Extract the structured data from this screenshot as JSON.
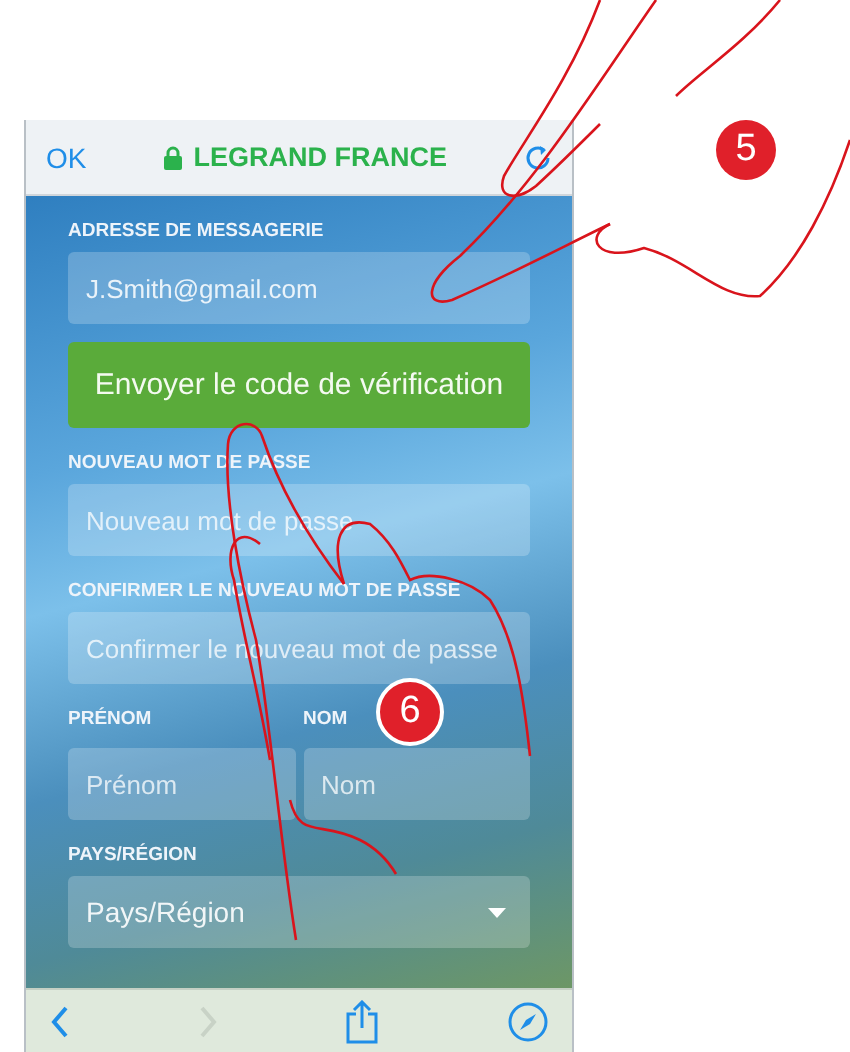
{
  "top_bar": {
    "done": "OK",
    "title": "LEGRAND FRANCE"
  },
  "form": {
    "email": {
      "label": "ADRESSE DE MESSAGERIE",
      "value": "J.Smith@gmail.com"
    },
    "send_button": "Envoyer le code de vérification",
    "new_password": {
      "label": "NOUVEAU MOT DE PASSE",
      "placeholder": "Nouveau mot de passe"
    },
    "confirm_password": {
      "label": "CONFIRMER LE NOUVEAU MOT DE PASSE",
      "placeholder": "Confirmer le nouveau mot de passe"
    },
    "first_name": {
      "label": "PRÉNOM",
      "placeholder": "Prénom"
    },
    "last_name": {
      "label": "NOM",
      "placeholder": "Nom"
    },
    "country": {
      "label": "PAYS/RÉGION",
      "value": "Pays/Région"
    }
  },
  "toolbar": {
    "back": {
      "disabled": false
    },
    "forward": {
      "disabled": true
    }
  },
  "callouts": [
    "5",
    "6"
  ]
}
